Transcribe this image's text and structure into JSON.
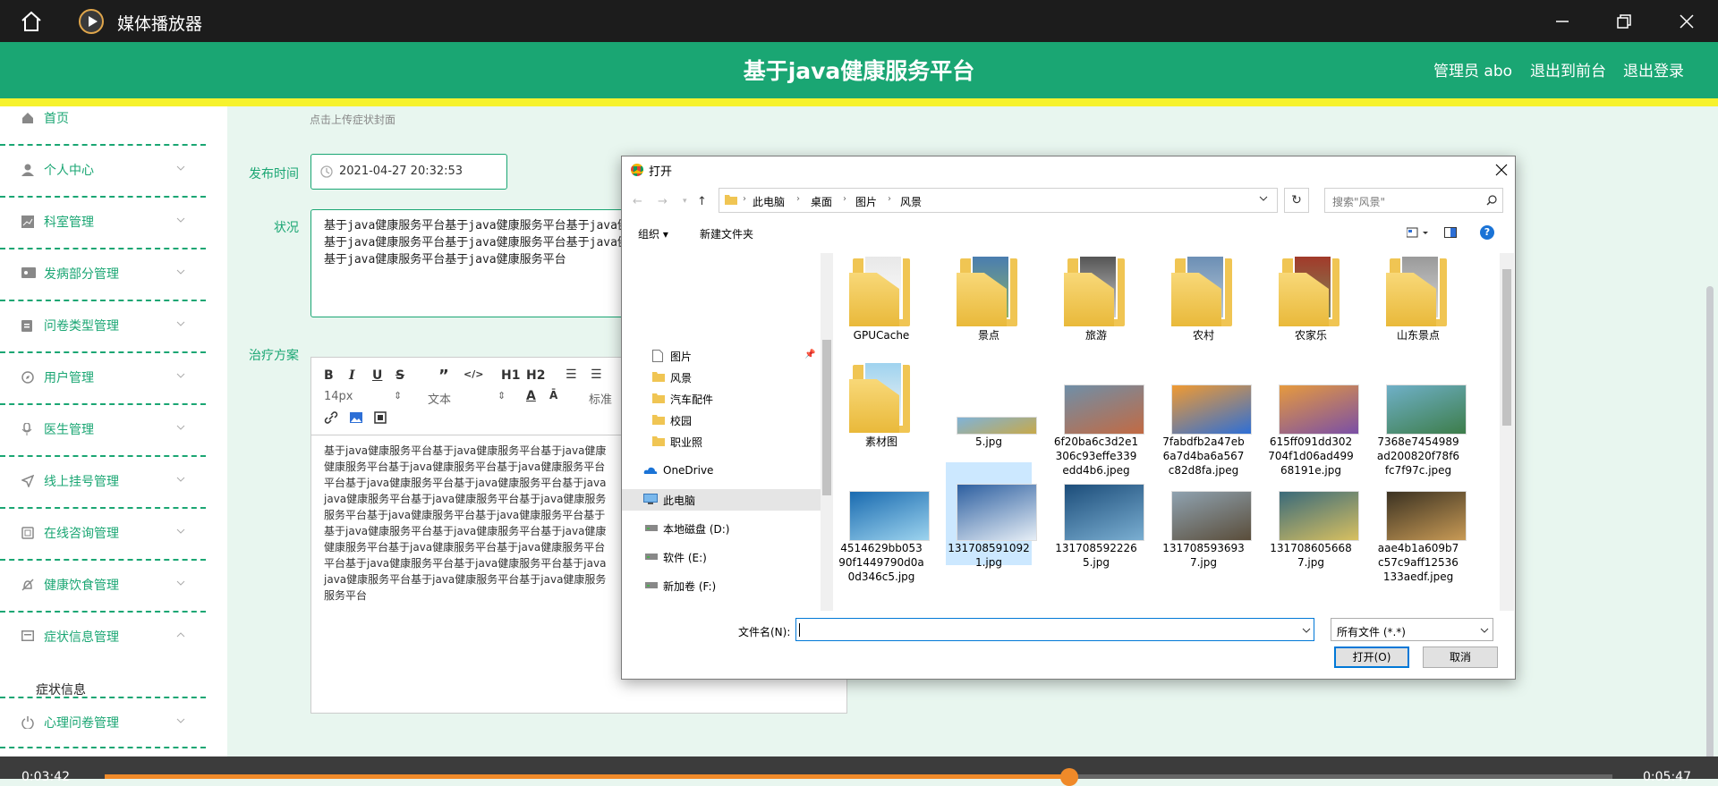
{
  "player": {
    "app_title": "媒体播放器",
    "time_current": "0:03:42",
    "time_total": "0:05:47",
    "progress_fraction": 0.64
  },
  "header": {
    "title": "基于java健康服务平台",
    "admin_label": "管理员 abo",
    "back_front_label": "退出到前台",
    "logout_label": "退出登录"
  },
  "sidebar": {
    "items": [
      {
        "label": "首页",
        "icon": "home-icon"
      },
      {
        "label": "个人中心",
        "icon": "user-icon"
      },
      {
        "label": "科室管理",
        "icon": "chart-icon"
      },
      {
        "label": "发病部分管理",
        "icon": "ticket-icon"
      },
      {
        "label": "问卷类型管理",
        "icon": "clipboard-icon"
      },
      {
        "label": "用户管理",
        "icon": "compass-icon"
      },
      {
        "label": "医生管理",
        "icon": "microphone-icon"
      },
      {
        "label": "线上挂号管理",
        "icon": "send-icon"
      },
      {
        "label": "在线咨询管理",
        "icon": "copy-icon"
      },
      {
        "label": "健康饮食管理",
        "icon": "bell-off-icon"
      },
      {
        "label": "症状信息管理",
        "icon": "card-icon"
      },
      {
        "label": "心理问卷管理",
        "icon": "power-icon"
      }
    ],
    "sub_item": "症状信息"
  },
  "form": {
    "upload_hint": "点击上传症状封面",
    "publish_time_label": "发布时间",
    "publish_time_value": "2021-04-27 20:32:53",
    "status_label": "状况",
    "status_lines": [
      "基于java健康服务平台基于java健康服务平台基于java健",
      "基于java健康服务平台基于java健康服务平台基于java健",
      "基于java健康服务平台基于java健康服务平台"
    ],
    "treatment_label": "治疗方案",
    "editor_toolbar": {
      "font_size": "14px",
      "text_style": "文本",
      "title_style": "标准",
      "h1": "H1",
      "h2": "H2"
    },
    "editor_lines": [
      "基于java健康服务平台基于java健康服务平台基于java健康",
      "健康服务平台基于java健康服务平台基于java健康服务平台",
      "平台基于java健康服务平台基于java健康服务平台基于java",
      "java健康服务平台基于java健康服务平台基于java健康服务",
      "服务平台基于java健康服务平台基于java健康服务平台基于",
      "基于java健康服务平台基于java健康服务平台基于java健康",
      "健康服务平台基于java健康服务平台基于java健康服务平台",
      "平台基于java健康服务平台基于java健康服务平台基于java",
      "java健康服务平台基于java健康服务平台基于java健康服务",
      "服务平台"
    ]
  },
  "dialog": {
    "title": "打开",
    "breadcrumbs": [
      "此电脑",
      "桌面",
      "图片",
      "风景"
    ],
    "search_placeholder": "搜索\"风景\"",
    "organize_label": "组织 ▾",
    "new_folder_label": "新建文件夹",
    "tree": [
      {
        "label": "图片",
        "icon": "image-doc-icon",
        "pinned": true
      },
      {
        "label": "风景",
        "icon": "folder-icon"
      },
      {
        "label": "汽车配件",
        "icon": "folder-icon"
      },
      {
        "label": "校园",
        "icon": "folder-icon"
      },
      {
        "label": "职业照",
        "icon": "folder-icon"
      },
      {
        "label": "OneDrive",
        "icon": "onedrive-icon"
      },
      {
        "label": "此电脑",
        "icon": "computer-icon",
        "selected": true
      },
      {
        "label": "本地磁盘 (D:)",
        "icon": "drive-icon"
      },
      {
        "label": "软件 (E:)",
        "icon": "drive-icon"
      },
      {
        "label": "新加卷 (F:)",
        "icon": "drive-icon"
      }
    ],
    "files": [
      {
        "name": "GPUCache",
        "kind": "folder",
        "c1": "#e8e8e8",
        "c2": "#ffffff"
      },
      {
        "name": "景点",
        "kind": "folder",
        "c1": "#4a7db0",
        "c2": "#8bb36a"
      },
      {
        "name": "旅游",
        "kind": "folder",
        "c1": "#555555",
        "c2": "#cfcfcf"
      },
      {
        "name": "农村",
        "kind": "folder",
        "c1": "#6c8fb5",
        "c2": "#b9c9d6"
      },
      {
        "name": "农家乐",
        "kind": "folder",
        "c1": "#a23a2a",
        "c2": "#7c8a5a"
      },
      {
        "name": "山东景点",
        "kind": "folder",
        "c1": "#9a9a9a",
        "c2": "#d8d8d8"
      },
      {
        "name": "素材图",
        "kind": "folder",
        "c1": "#9fd3ef",
        "c2": "#f4f4f4"
      },
      {
        "name": "5.jpg",
        "kind": "image",
        "c1": "#7fb3d9",
        "c2": "#c7a94a",
        "h": 20
      },
      {
        "name": "6f20ba6c3d2e1306c93effe339edd4b6.jpeg",
        "kind": "image",
        "c1": "#6f8fa8",
        "c2": "#c26a43",
        "h": 56
      },
      {
        "name": "7fabdfb2a47eb6a7d4ba6a567c82d8fa.jpeg",
        "kind": "image",
        "c1": "#f09a32",
        "c2": "#2e6fd6",
        "h": 56
      },
      {
        "name": "615ff091dd302704f1d06ad49968191e.jpg",
        "kind": "image",
        "c1": "#e69a3e",
        "c2": "#7a4fa6",
        "h": 56
      },
      {
        "name": "7368e7454989ad200820f78f6fc7f97c.jpeg",
        "kind": "image",
        "c1": "#6fb0c8",
        "c2": "#3d7d4a",
        "h": 56
      },
      {
        "name": "4514629bb05390f1449790d0a0d346c5.jpg",
        "kind": "image",
        "c1": "#1a6bb0",
        "c2": "#9cd3ee",
        "h": 56
      },
      {
        "name": "1317085910921.jpg",
        "kind": "image",
        "c1": "#2d5fa0",
        "c2": "#e6eef6",
        "h": 64,
        "selected": true
      },
      {
        "name": "1317085922265.jpg",
        "kind": "image",
        "c1": "#1c4d7a",
        "c2": "#7aaed1",
        "h": 64
      },
      {
        "name": "1317085936937.jpg",
        "kind": "image",
        "c1": "#8fa2b0",
        "c2": "#5a4d3a",
        "h": 56
      },
      {
        "name": "1317086056687.jpg",
        "kind": "image",
        "c1": "#3a6a7a",
        "c2": "#d8c060",
        "h": 56
      },
      {
        "name": "aae4b1a609b7c57c9aff12536133aedf.jpeg",
        "kind": "image",
        "c1": "#3b3222",
        "c2": "#c89a55",
        "h": 56
      }
    ],
    "filename_label": "文件名(N):",
    "filename_value": "",
    "file_type": "所有文件 (*.*)",
    "open_button": "打开(O)",
    "cancel_button": "取消"
  },
  "colors": {
    "brand": "#1aa673",
    "accent_yellow": "#f6f22d",
    "progress": "#f08a29"
  }
}
